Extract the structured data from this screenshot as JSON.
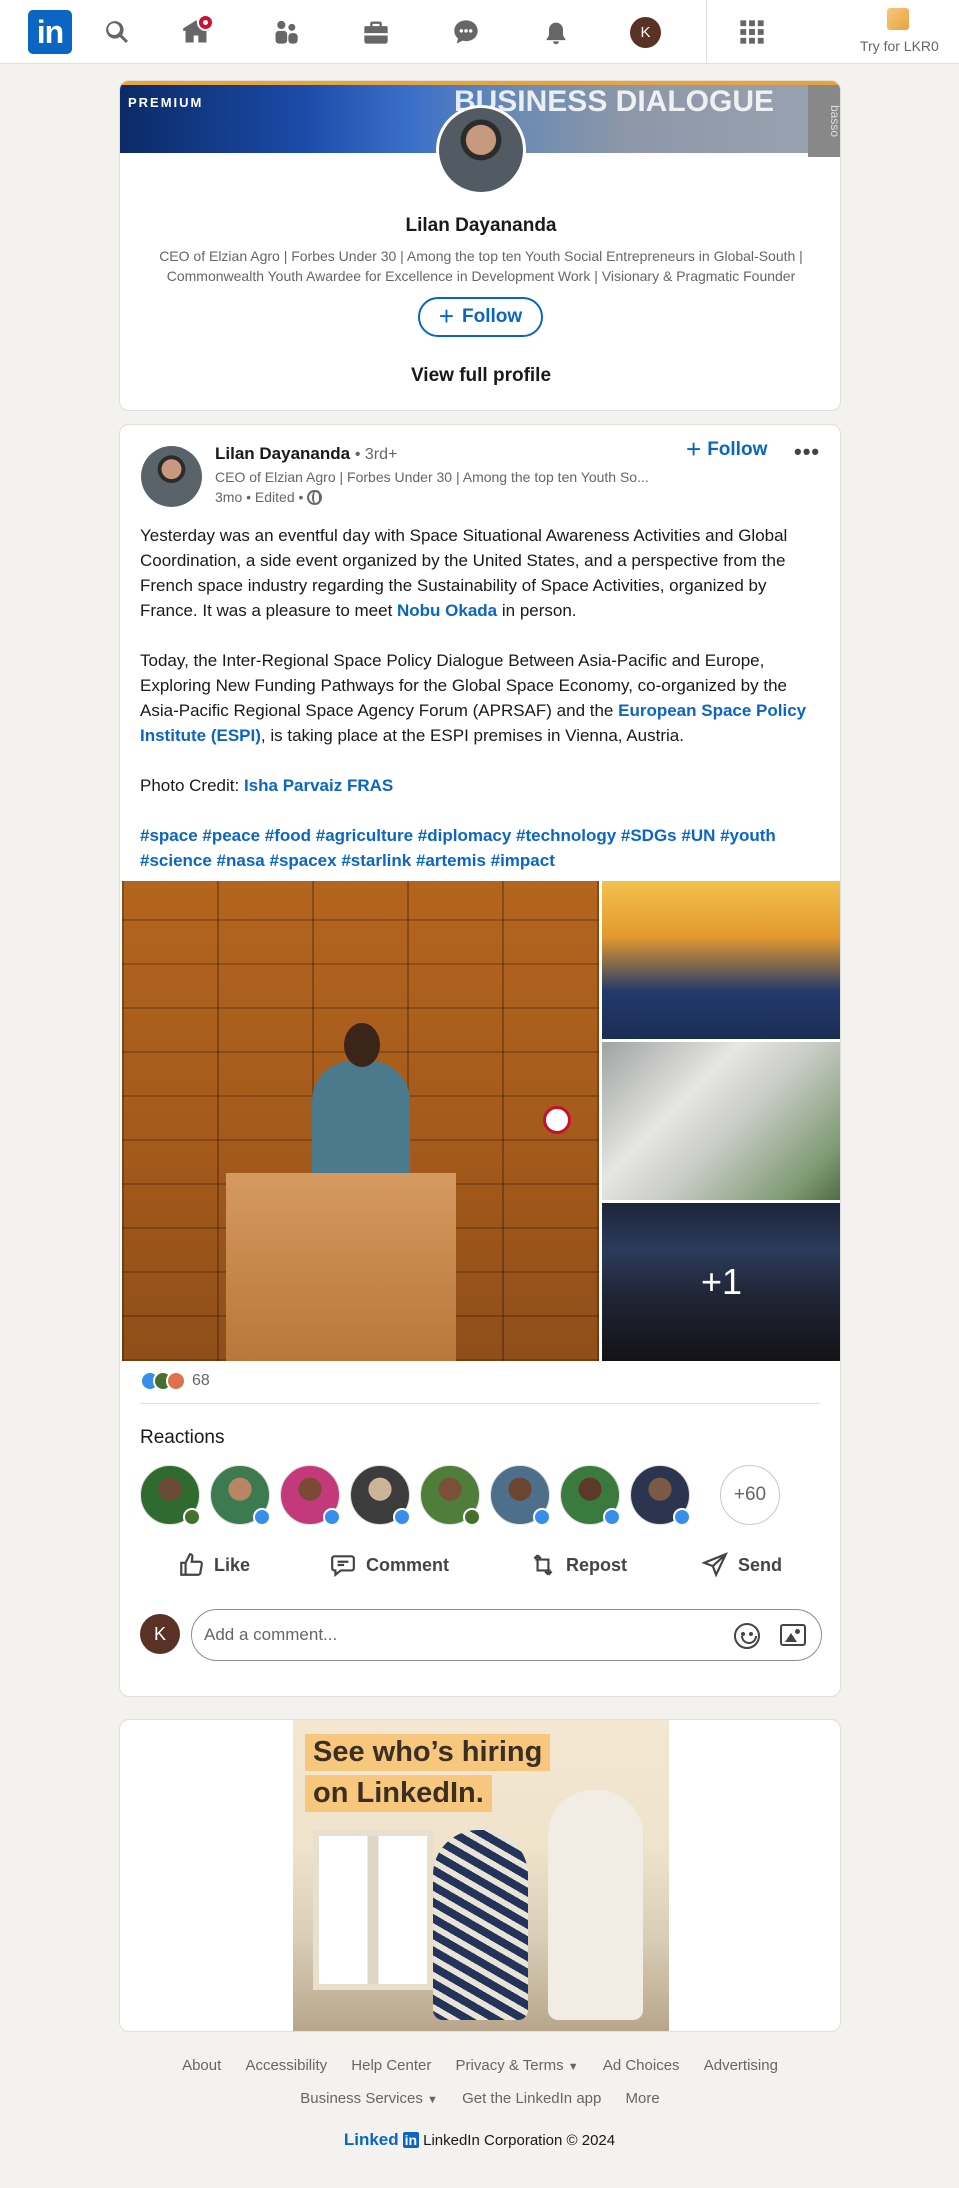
{
  "nav": {
    "logo_text": "in",
    "try_premium_label": "Try for LKR0",
    "profile_initial": "K",
    "icons": [
      "search-icon",
      "home-icon",
      "my-network-icon",
      "jobs-icon",
      "messaging-icon",
      "notifications-icon",
      "me-avatar",
      "apps-grid-icon"
    ]
  },
  "profile_card": {
    "banner_label": "PREMIUM",
    "banner_text": "BUSINESS DIALOGUE",
    "banner_side_text": "basso",
    "name": "Lilan Dayananda",
    "headline": "CEO of Elzian Agro | Forbes Under 30 | Among the top ten Youth Social Entrepreneurs in Global-South | Commonwealth Youth Awardee for Excellence in Development Work | Visionary & Pragmatic Founder",
    "follow_label": "Follow",
    "view_profile_label": "View full profile"
  },
  "post": {
    "author_name": "Lilan Dayananda",
    "degree": "• 3rd+",
    "author_headline": "CEO of Elzian Agro | Forbes Under 30 | Among the top ten Youth So...",
    "meta": "3mo • Edited •",
    "follow_label": "Follow",
    "more_label": "•••",
    "para1_pre": "Yesterday was an eventful day with Space Situational Awareness Activities and Global Coordination, a side event organized by the United States, and a perspective from the French space industry regarding the Sustainability of Space Activities, organized by France. It was a pleasure to meet ",
    "para1_link": "Nobu Okada",
    "para1_post": " in person.",
    "para2_pre": "Today, the Inter-Regional Space Policy Dialogue Between Asia-Pacific and Europe, Exploring New Funding Pathways for the Global Space Economy, co-organized by the Asia-Pacific Regional Space Agency Forum (APRSAF) and the ",
    "para2_link": "European Space Policy Institute (ESPI)",
    "para2_post": ", is taking place at the ESPI premises in Vienna, Austria.",
    "photo_credit_label": "Photo Credit: ",
    "photo_credit_link": "Isha Parvaiz FRAS",
    "hashtags_line1": "#space #peace #food #agriculture #diplomacy #technology #SDGs #UN #youth",
    "hashtags_line2": "#science #nasa #spacex #starlink #artemis #impact",
    "more_photos_label": "+1",
    "reaction_count": "68",
    "reactions_title": "Reactions",
    "more_reactors_label": "+60",
    "actions": {
      "like": "Like",
      "comment": "Comment",
      "repost": "Repost",
      "send": "Send"
    },
    "comment_initial": "K",
    "comment_placeholder": "Add a comment..."
  },
  "ad": {
    "line1": "See who’s hiring",
    "line2": "on LinkedIn."
  },
  "footer": {
    "links_row1": [
      "About",
      "Accessibility",
      "Help Center",
      "Privacy & Terms",
      "Ad Choices",
      "Advertising"
    ],
    "links_row2": [
      "Business Services",
      "Get the LinkedIn app",
      "More"
    ],
    "brand_word": "Linked",
    "brand_box": "in",
    "copyright": "LinkedIn Corporation © 2024"
  },
  "colors": {
    "brand": "#0a66c2",
    "background": "#f4f2ee",
    "premium_gold": "#e7a33e",
    "notification_red": "#cb112d"
  }
}
